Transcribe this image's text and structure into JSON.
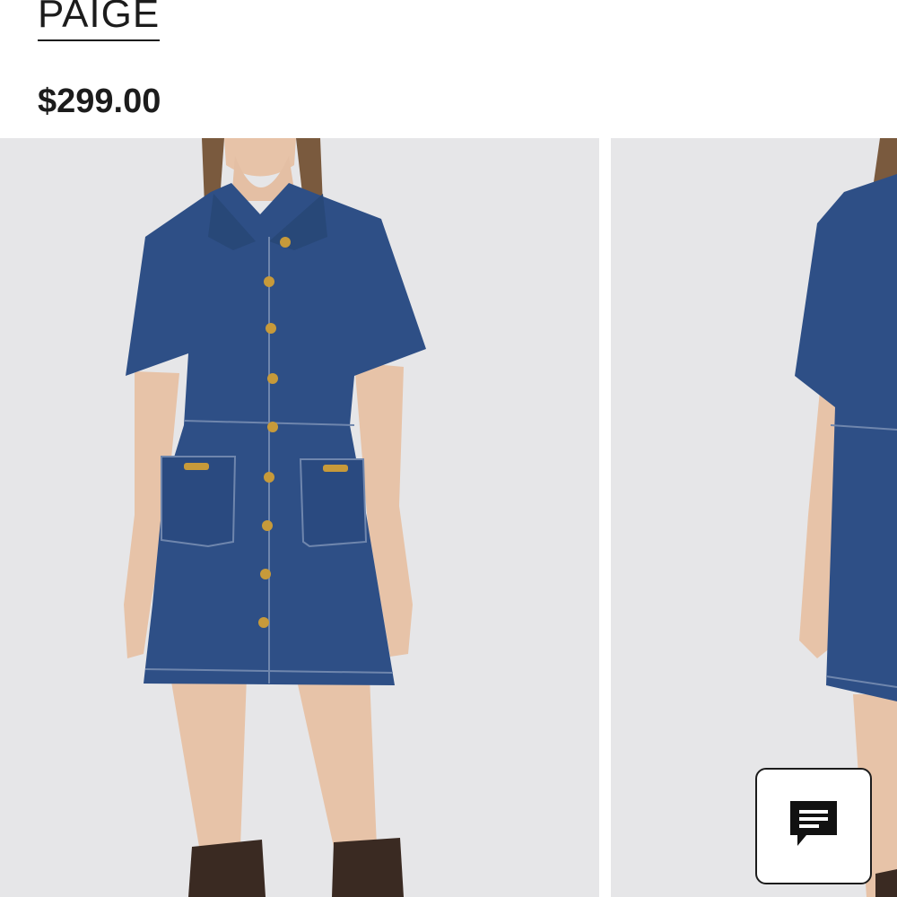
{
  "product": {
    "brand": "PAIGE",
    "price": "$299.00"
  },
  "gallery": {
    "images": [
      {
        "alt_semantic": "model-front-view"
      },
      {
        "alt_semantic": "model-side-view"
      }
    ]
  },
  "chat": {
    "icon": "chat-bubble-icon"
  },
  "colors": {
    "text": "#1c1c1c",
    "photo_background": "#e6e6e8",
    "denim": "#2e4f86",
    "button_accent": "#c79a3a"
  }
}
